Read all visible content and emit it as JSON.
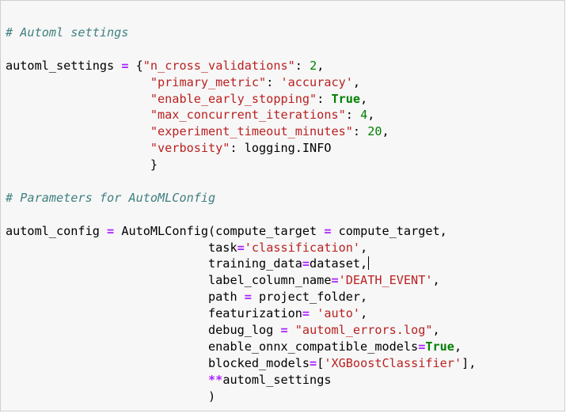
{
  "code_lines": [
    [
      {
        "t": "cmt",
        "v": "# Automl settings"
      }
    ],
    [],
    [
      {
        "t": "txt",
        "v": "automl_settings "
      },
      {
        "t": "op",
        "v": "="
      },
      {
        "t": "txt",
        "v": " {"
      },
      {
        "t": "str",
        "v": "\"n_cross_validations\""
      },
      {
        "t": "txt",
        "v": ": "
      },
      {
        "t": "num",
        "v": "2"
      },
      {
        "t": "txt",
        "v": ","
      }
    ],
    [
      {
        "t": "txt",
        "v": "                    "
      },
      {
        "t": "str",
        "v": "\"primary_metric\""
      },
      {
        "t": "txt",
        "v": ": "
      },
      {
        "t": "str",
        "v": "'accuracy'"
      },
      {
        "t": "txt",
        "v": ","
      }
    ],
    [
      {
        "t": "txt",
        "v": "                    "
      },
      {
        "t": "str",
        "v": "\"enable_early_stopping\""
      },
      {
        "t": "txt",
        "v": ": "
      },
      {
        "t": "kw",
        "v": "True"
      },
      {
        "t": "txt",
        "v": ","
      }
    ],
    [
      {
        "t": "txt",
        "v": "                    "
      },
      {
        "t": "str",
        "v": "\"max_concurrent_iterations\""
      },
      {
        "t": "txt",
        "v": ": "
      },
      {
        "t": "num",
        "v": "4"
      },
      {
        "t": "txt",
        "v": ","
      }
    ],
    [
      {
        "t": "txt",
        "v": "                    "
      },
      {
        "t": "str",
        "v": "\"experiment_timeout_minutes\""
      },
      {
        "t": "txt",
        "v": ": "
      },
      {
        "t": "num",
        "v": "20"
      },
      {
        "t": "txt",
        "v": ","
      }
    ],
    [
      {
        "t": "txt",
        "v": "                    "
      },
      {
        "t": "str",
        "v": "\"verbosity\""
      },
      {
        "t": "txt",
        "v": ": logging.INFO"
      }
    ],
    [
      {
        "t": "txt",
        "v": "                    }"
      }
    ],
    [],
    [
      {
        "t": "cmt",
        "v": "# Parameters for AutoMLConfig"
      }
    ],
    [],
    [
      {
        "t": "txt",
        "v": "automl_config "
      },
      {
        "t": "op",
        "v": "="
      },
      {
        "t": "txt",
        "v": " AutoMLConfig(compute_target "
      },
      {
        "t": "op",
        "v": "="
      },
      {
        "t": "txt",
        "v": " compute_target,"
      }
    ],
    [
      {
        "t": "txt",
        "v": "                            task"
      },
      {
        "t": "op",
        "v": "="
      },
      {
        "t": "str",
        "v": "'classification'"
      },
      {
        "t": "txt",
        "v": ","
      }
    ],
    [
      {
        "t": "txt",
        "v": "                            training_data"
      },
      {
        "t": "op",
        "v": "="
      },
      {
        "t": "txt",
        "v": "dataset,"
      },
      {
        "t": "cursor",
        "v": ""
      }
    ],
    [
      {
        "t": "txt",
        "v": "                            label_column_name"
      },
      {
        "t": "op",
        "v": "="
      },
      {
        "t": "str",
        "v": "'DEATH_EVENT'"
      },
      {
        "t": "txt",
        "v": ","
      }
    ],
    [
      {
        "t": "txt",
        "v": "                            path "
      },
      {
        "t": "op",
        "v": "="
      },
      {
        "t": "txt",
        "v": " project_folder,"
      }
    ],
    [
      {
        "t": "txt",
        "v": "                            featurization"
      },
      {
        "t": "op",
        "v": "="
      },
      {
        "t": "txt",
        "v": " "
      },
      {
        "t": "str",
        "v": "'auto'"
      },
      {
        "t": "txt",
        "v": ","
      }
    ],
    [
      {
        "t": "txt",
        "v": "                            debug_log "
      },
      {
        "t": "op",
        "v": "="
      },
      {
        "t": "txt",
        "v": " "
      },
      {
        "t": "str",
        "v": "\"automl_errors.log\""
      },
      {
        "t": "txt",
        "v": ","
      }
    ],
    [
      {
        "t": "txt",
        "v": "                            enable_onnx_compatible_models"
      },
      {
        "t": "op",
        "v": "="
      },
      {
        "t": "kw",
        "v": "True"
      },
      {
        "t": "txt",
        "v": ","
      }
    ],
    [
      {
        "t": "txt",
        "v": "                            blocked_models"
      },
      {
        "t": "op",
        "v": "="
      },
      {
        "t": "txt",
        "v": "["
      },
      {
        "t": "str",
        "v": "'XGBoostClassifier'"
      },
      {
        "t": "txt",
        "v": "],"
      }
    ],
    [
      {
        "t": "txt",
        "v": "                            "
      },
      {
        "t": "op",
        "v": "**"
      },
      {
        "t": "txt",
        "v": "automl_settings"
      }
    ],
    [
      {
        "t": "txt",
        "v": "                            )"
      }
    ]
  ]
}
